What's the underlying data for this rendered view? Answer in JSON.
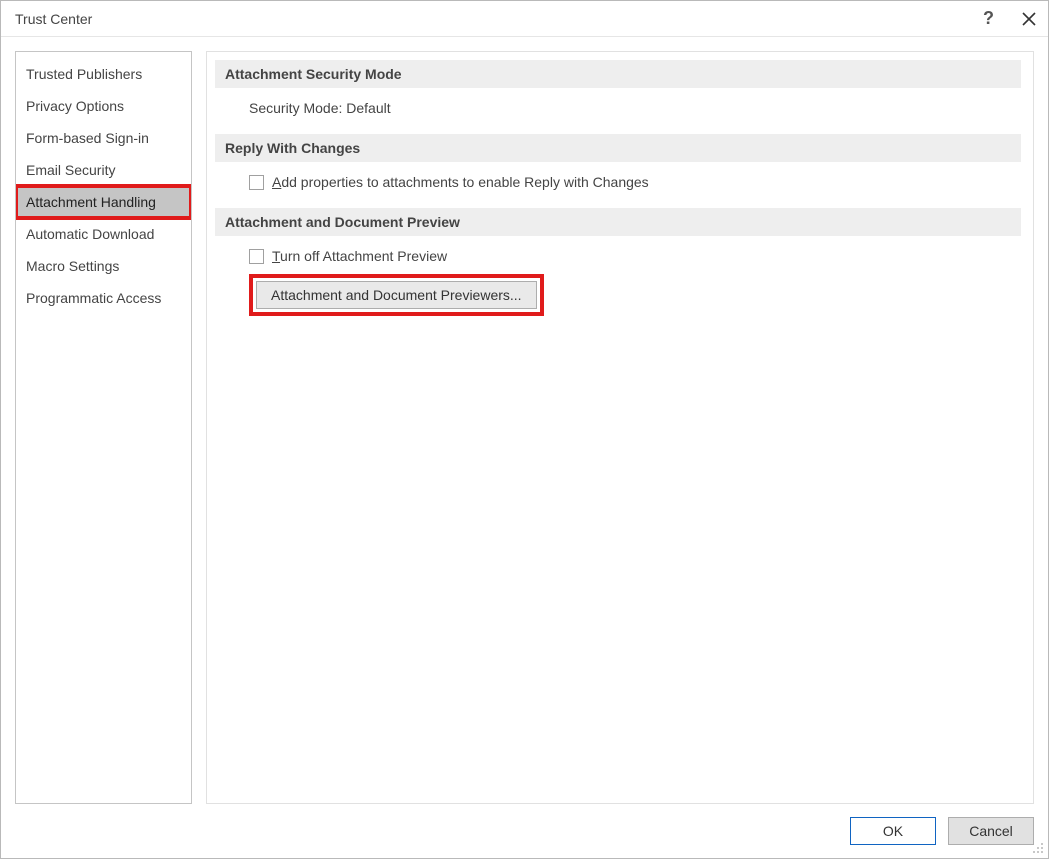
{
  "window": {
    "title": "Trust Center"
  },
  "sidebar": {
    "items": [
      {
        "label": "Trusted Publishers",
        "selected": false
      },
      {
        "label": "Privacy Options",
        "selected": false
      },
      {
        "label": "Form-based Sign-in",
        "selected": false
      },
      {
        "label": "Email Security",
        "selected": false
      },
      {
        "label": "Attachment Handling",
        "selected": true,
        "highlighted": true
      },
      {
        "label": "Automatic Download",
        "selected": false
      },
      {
        "label": "Macro Settings",
        "selected": false
      },
      {
        "label": "Programmatic Access",
        "selected": false
      }
    ]
  },
  "sections": {
    "securityMode": {
      "header": "Attachment Security Mode",
      "label": "Security Mode:",
      "value": "Default"
    },
    "replyChanges": {
      "header": "Reply With Changes",
      "checkbox_prefix": "A",
      "checkbox_rest": "dd properties to attachments to enable Reply with Changes",
      "checked": false
    },
    "preview": {
      "header": "Attachment and Document Preview",
      "checkbox_prefix": "T",
      "checkbox_rest": "urn off Attachment Preview",
      "checked": false,
      "button_pre": "Attachment and Document ",
      "button_ul": "P",
      "button_post": "reviewers...",
      "button_highlighted": true
    }
  },
  "footer": {
    "ok": "OK",
    "cancel": "Cancel"
  }
}
